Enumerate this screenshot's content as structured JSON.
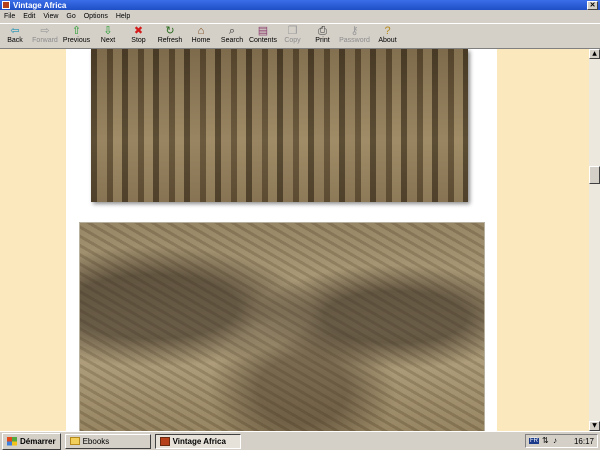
{
  "window": {
    "title": "Vintage Africa"
  },
  "menu": [
    "File",
    "Edit",
    "View",
    "Go",
    "Options",
    "Help"
  ],
  "toolbar": [
    {
      "label": "Back",
      "icon": "back-arrow-icon",
      "glyph": "⇦",
      "color": "#1e8fb3",
      "enabled": true
    },
    {
      "label": "Forward",
      "icon": "forward-arrow-icon",
      "glyph": "⇨",
      "color": "#9a9a9a",
      "enabled": false
    },
    {
      "label": "Previous",
      "icon": "up-arrow-icon",
      "glyph": "⇧",
      "color": "#1e9c2a",
      "enabled": true
    },
    {
      "label": "Next",
      "icon": "down-arrow-icon",
      "glyph": "⇩",
      "color": "#1e9c2a",
      "enabled": true
    },
    {
      "label": "Stop",
      "icon": "stop-icon",
      "glyph": "✖",
      "color": "#d41a1a",
      "enabled": true
    },
    {
      "label": "Refresh",
      "icon": "refresh-icon",
      "glyph": "↻",
      "color": "#2a6b1e",
      "enabled": true
    },
    {
      "label": "Home",
      "icon": "home-icon",
      "glyph": "⌂",
      "color": "#7a4a1a",
      "enabled": true
    },
    {
      "label": "Search",
      "icon": "search-icon",
      "glyph": "⌕",
      "color": "#333333",
      "enabled": true
    },
    {
      "label": "Contents",
      "icon": "contents-icon",
      "glyph": "▤",
      "color": "#8a3a6a",
      "enabled": true
    },
    {
      "label": "Copy",
      "icon": "copy-icon",
      "glyph": "❐",
      "color": "#9a9a9a",
      "enabled": false
    },
    {
      "label": "Print",
      "icon": "print-icon",
      "glyph": "⎙",
      "color": "#333333",
      "enabled": true
    },
    {
      "label": "Password",
      "icon": "key-icon",
      "glyph": "⚷",
      "color": "#9a9a9a",
      "enabled": false
    },
    {
      "label": "About",
      "icon": "question-icon",
      "glyph": "?",
      "color": "#b68a1d",
      "enabled": true
    }
  ],
  "colors": {
    "page_background": "#fbe8bc",
    "titlebar": "#1f4fc7"
  },
  "taskbar": {
    "start_label": "Démarrer",
    "tasks": [
      {
        "label": "Ebooks",
        "icon": "folder-icon",
        "active": false
      },
      {
        "label": "Vintage Africa",
        "icon": "app-icon",
        "active": true
      }
    ],
    "tray": {
      "language": "FR",
      "clock": "16:17"
    }
  }
}
